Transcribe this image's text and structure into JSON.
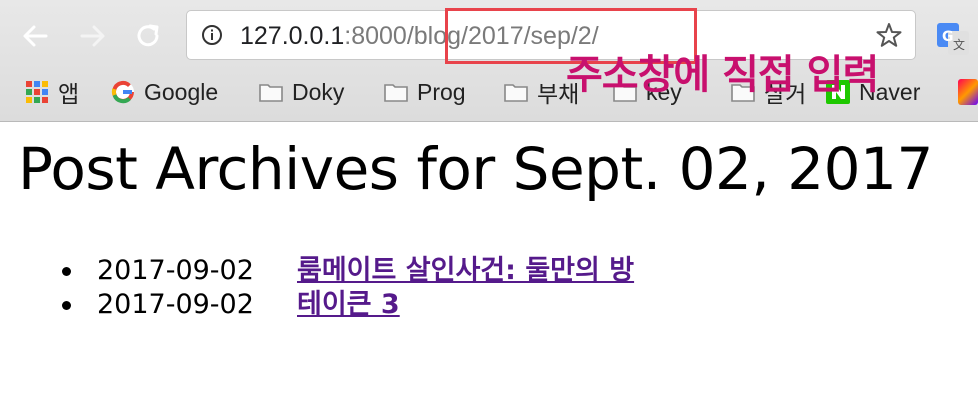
{
  "browser": {
    "url_host": "127.0.0.1",
    "url_port": ":8000",
    "url_path": "/blog/2017/sep/2/",
    "bookmarks": [
      {
        "label": "앱",
        "icon": "apps-grid-icon"
      },
      {
        "label": "Google",
        "icon": "google-icon"
      },
      {
        "label": "Doky",
        "icon": "folder-icon"
      },
      {
        "label": "Prog",
        "icon": "folder-icon"
      },
      {
        "label": "부채",
        "icon": "folder-icon"
      },
      {
        "label": "key",
        "icon": "folder-icon"
      },
      {
        "label": "살거",
        "icon": "folder-icon"
      },
      {
        "label": "Naver",
        "icon": "naver-icon"
      }
    ]
  },
  "annotation": {
    "text": "주소창에 직접 입력",
    "color": "#c8106e",
    "box_color": "#e8434b"
  },
  "page": {
    "heading": "Post Archives for Sept. 02, 2017",
    "posts": [
      {
        "date": "2017-09-02",
        "title": "룸메이트 살인사건: 둘만의 방"
      },
      {
        "date": "2017-09-02",
        "title": "테이큰 3"
      }
    ],
    "link_color": "#551a8b"
  }
}
